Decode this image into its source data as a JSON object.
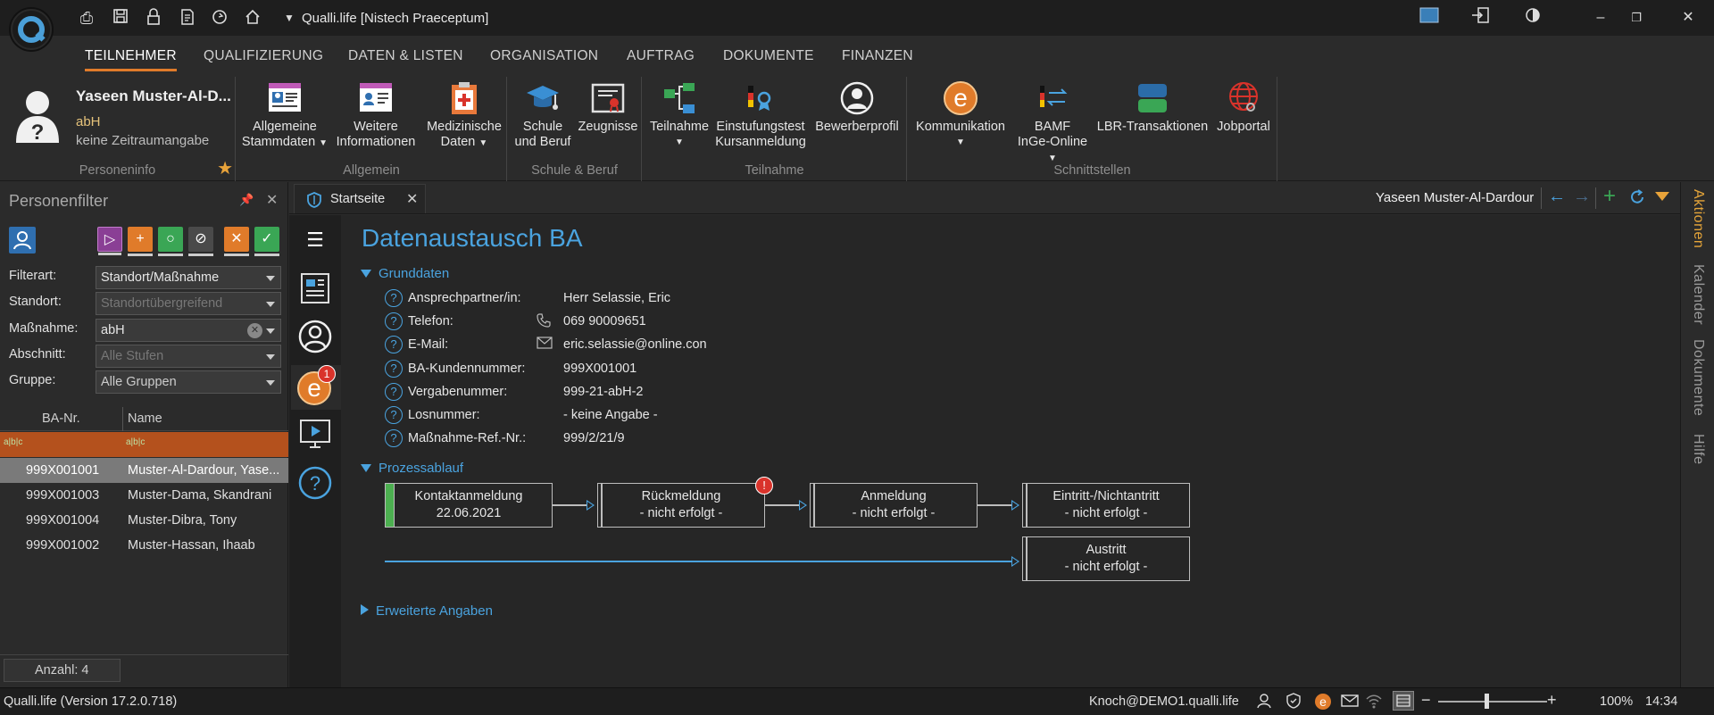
{
  "window": {
    "title": "Qualli.life [Nistech Praeceptum]"
  },
  "menu_tabs": [
    "TEILNEHMER",
    "QUALIFIZIERUNG",
    "DATEN & LISTEN",
    "ORGANISATION",
    "AUFTRAG",
    "DOKUMENTE",
    "FINANZEN"
  ],
  "person": {
    "name": "Yaseen Muster-Al-D...",
    "measure": "abH",
    "period": "keine Zeitraumangabe",
    "group_label": "Personeninfo"
  },
  "ribbon": {
    "allgemein": {
      "label": "Allgemein",
      "stammdaten": [
        "Allgemeine",
        "Stammdaten"
      ],
      "weitere": [
        "Weitere",
        "Informationen"
      ],
      "medizin": [
        "Medizinische",
        "Daten"
      ]
    },
    "schule": {
      "label": "Schule & Beruf",
      "schule": [
        "Schule",
        "und Beruf"
      ],
      "zeugnisse": "Zeugnisse"
    },
    "teilnahme": {
      "label": "Teilnahme",
      "teilnahme": "Teilnahme",
      "einstufung": [
        "Einstufungstest",
        "Kursanmeldung"
      ],
      "bewerber": "Bewerberprofil"
    },
    "schnitt": {
      "label": "Schnittstellen",
      "kommunikation": "Kommunikation",
      "bamf": [
        "BAMF",
        "InGe-Online"
      ],
      "lbr": "LBR-Transaktionen",
      "jobportal": "Jobportal"
    }
  },
  "filter": {
    "title": "Personenfilter",
    "rows": [
      {
        "label": "Filterart:",
        "value": "Standort/Maßnahme"
      },
      {
        "label": "Standort:",
        "value": "Standortübergreifend"
      },
      {
        "label": "Maßnahme:",
        "value": "abH"
      },
      {
        "label": "Abschnitt:",
        "value": "Alle Stufen"
      },
      {
        "label": "Gruppe:",
        "value": "Alle Gruppen"
      }
    ]
  },
  "table": {
    "headers": [
      "BA-Nr.",
      "Name"
    ],
    "filter_row": [
      "a|b|c",
      "a|b|c"
    ],
    "rows": [
      [
        "999X001001",
        "Muster-Al-Dardour, Yase..."
      ],
      [
        "999X001003",
        "Muster-Dama, Skandrani"
      ],
      [
        "999X001004",
        "Muster-Dibra, Tony"
      ],
      [
        "999X001002",
        "Muster-Hassan, Ihaab"
      ]
    ],
    "count": "Anzahl: 4"
  },
  "doc": {
    "tab_label": "Startseite",
    "person_header": "Yaseen Muster-Al-Dardour",
    "badge": "1",
    "title": "Datenaustausch BA",
    "section_grunddaten": "Grunddaten",
    "fields": [
      {
        "label": "Ansprechpartner/in:",
        "value": "Herr Selassie, Eric",
        "icon": ""
      },
      {
        "label": "Telefon:",
        "value": "069 90009651",
        "icon": "phone-icon"
      },
      {
        "label": "E-Mail:",
        "value": "eric.selassie@online.con",
        "icon": "mail-icon"
      },
      {
        "label": "BA-Kundennummer:",
        "value": "999X001001",
        "icon": ""
      },
      {
        "label": "Vergabenummer:",
        "value": "999-21-abH-2",
        "icon": ""
      },
      {
        "label": "Losnummer:",
        "value": "- keine Angabe -",
        "icon": ""
      },
      {
        "label": "Maßnahme-Ref.-Nr.:",
        "value": "999/2/21/9",
        "icon": ""
      }
    ],
    "section_prozess": "Prozessablauf",
    "process": [
      {
        "title": "Kontaktanmeldung",
        "status": "22.06.2021"
      },
      {
        "title": "Rückmeldung",
        "status": "- nicht erfolgt -",
        "alert": "!"
      },
      {
        "title": "Anmeldung",
        "status": "- nicht erfolgt -"
      },
      {
        "title": "Eintritt-/Nichtantritt",
        "status": "- nicht erfolgt -"
      },
      {
        "title": "Austritt",
        "status": "- nicht erfolgt -"
      }
    ],
    "section_erweitert": "Erweiterte Angaben"
  },
  "right_tabs": [
    "Aktionen",
    "Kalender",
    "Dokumente",
    "Hilfe"
  ],
  "status": {
    "version": "Qualli.life (Version 17.2.0.718)",
    "user": "Knoch@DEMO1.qualli.life",
    "zoom": "100%",
    "time": "14:34"
  },
  "colors": {
    "accent": "#4aa3df",
    "active_tab": "#e07b2a",
    "selected_row": "#b4511d",
    "success": "#4caf50"
  }
}
